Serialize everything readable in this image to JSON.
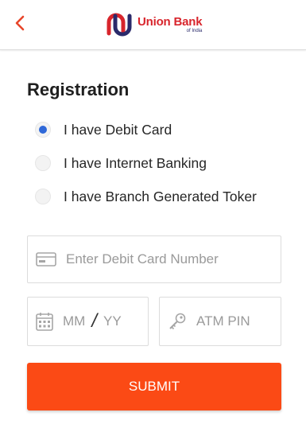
{
  "header": {
    "back_icon": "chevron-left-icon",
    "logo": {
      "name": "Union Bank",
      "sub": "of India"
    }
  },
  "form": {
    "title": "Registration",
    "options": [
      {
        "label": "I have Debit Card",
        "selected": true
      },
      {
        "label": "I have Internet Banking",
        "selected": false
      },
      {
        "label": "I have Branch Generated Toker",
        "selected": false
      }
    ],
    "card_number": {
      "placeholder": "Enter Debit Card Number",
      "icon": "credit-card-icon"
    },
    "expiry": {
      "month_placeholder": "MM",
      "separator": "/",
      "year_placeholder": "YY",
      "icon": "calendar-icon"
    },
    "pin": {
      "placeholder": "ATM PIN",
      "icon": "key-icon"
    },
    "submit_label": "SUBMIT"
  },
  "colors": {
    "accent": "#fb4a15",
    "brand_red": "#d8252c",
    "brand_navy": "#2a2a6a",
    "radio_selected": "#2f68d8"
  }
}
